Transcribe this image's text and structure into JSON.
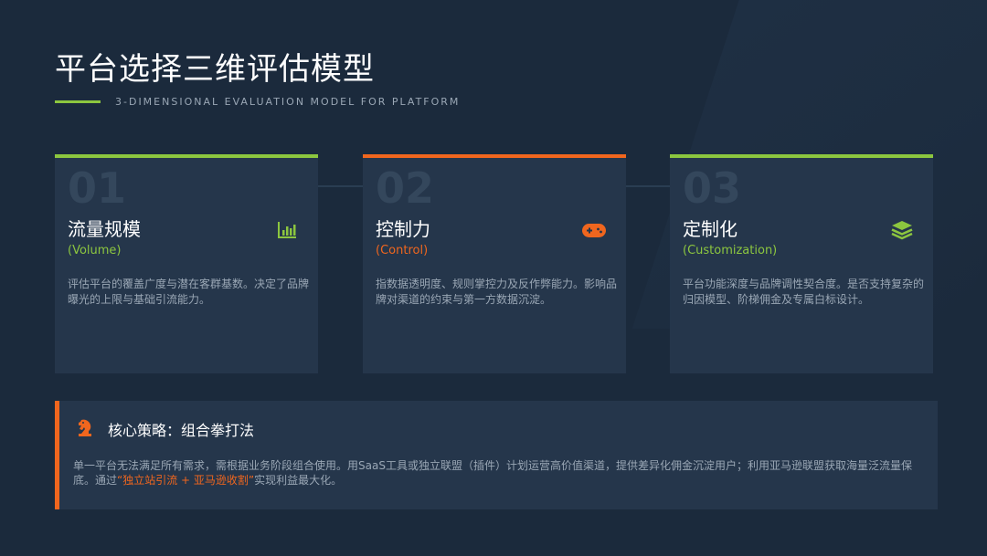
{
  "header": {
    "title": "平台选择三维评估模型",
    "subtitle": "3-DIMENSIONAL EVALUATION MODEL FOR PLATFORM"
  },
  "colors": {
    "green": "#8cc63f",
    "orange": "#f0661e",
    "background": "#1b2a3c",
    "card": "#25364b",
    "muted_text": "#9aa7b5"
  },
  "cards": [
    {
      "number": "01",
      "title": "流量规模",
      "english": "(Volume)",
      "description": "评估平台的覆盖广度与潜在客群基数。决定了品牌曝光的上限与基础引流能力。",
      "icon": "bar-chart-icon",
      "accent": "#8cc63f"
    },
    {
      "number": "02",
      "title": "控制力",
      "english": "(Control)",
      "description": "指数据透明度、规则掌控力及反作弊能力。影响品牌对渠道的约束与第一方数据沉淀。",
      "icon": "gamepad-icon",
      "accent": "#f0661e"
    },
    {
      "number": "03",
      "title": "定制化",
      "english": "(Customization)",
      "description": "平台功能深度与品牌调性契合度。是否支持复杂的归因模型、阶梯佣金及专属白标设计。",
      "icon": "layers-icon",
      "accent": "#8cc63f"
    }
  ],
  "strategy": {
    "icon": "chess-knight-icon",
    "title": "核心策略：组合拳打法",
    "text_before": "单一平台无法满足所有需求，需根据业务阶段组合使用。用SaaS工具或独立联盟（插件）计划运营高价值渠道，提供差异化佣金沉淀用户；利用亚马逊联盟获取海量泛流量保底。通过",
    "highlight": "“独立站引流 + 亚马逊收割”",
    "text_after": "实现利益最大化。"
  }
}
